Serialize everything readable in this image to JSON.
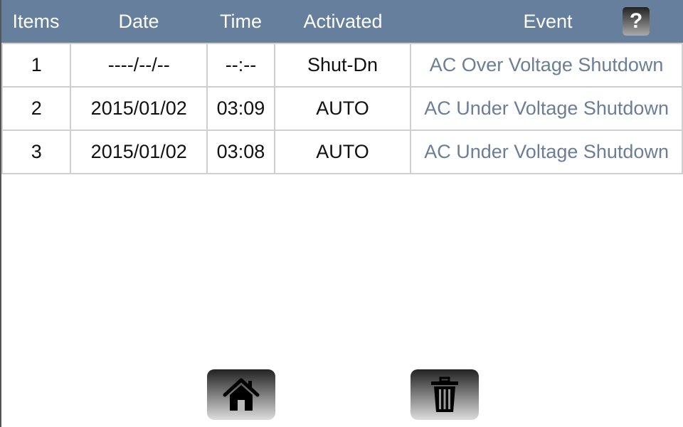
{
  "header": {
    "columns": [
      "Items",
      "Date",
      "Time",
      "Activated",
      "Event"
    ],
    "help_label": "?"
  },
  "rows": [
    {
      "item": "1",
      "date": "----/--/--",
      "time": "--:--",
      "activated": "Shut-Dn",
      "event": "AC Over Voltage Shutdown"
    },
    {
      "item": "2",
      "date": "2015/01/02",
      "time": "03:09",
      "activated": "AUTO",
      "event": "AC Under Voltage Shutdown"
    },
    {
      "item": "3",
      "date": "2015/01/02",
      "time": "03:08",
      "activated": "AUTO",
      "event": "AC Under Voltage Shutdown"
    }
  ],
  "footer": {
    "home_icon": "home-icon",
    "delete_icon": "trash-icon"
  },
  "colors": {
    "header": "#657f9c",
    "event_text": "#6b7e96"
  }
}
